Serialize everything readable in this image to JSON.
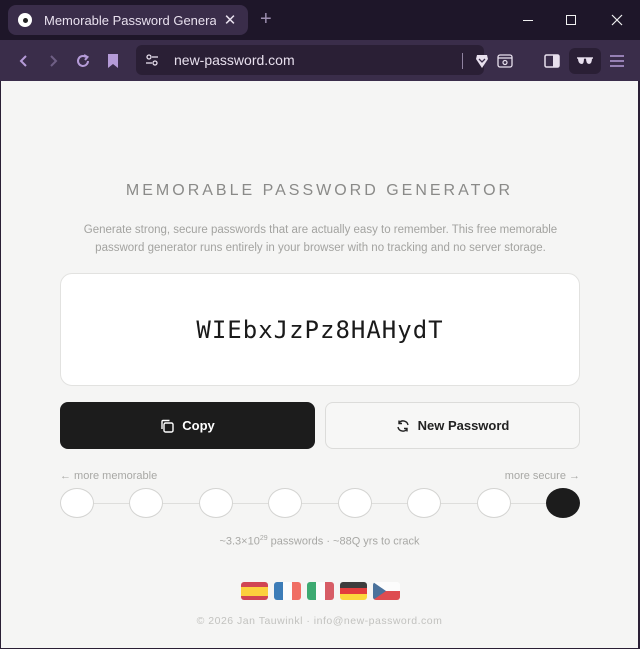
{
  "browser": {
    "tab_title": "Memorable Password Generator",
    "tab_close": "✕",
    "new_tab": "+",
    "url": "new-password.com"
  },
  "page": {
    "heading": "MEMORABLE PASSWORD GENERATOR",
    "description": "Generate strong, secure passwords that are actually easy to remember. This free memorable password generator runs entirely in your browser with no tracking and no server storage.",
    "password": "WIEbxJzPz8HAHydT",
    "copy_label": "Copy",
    "new_password_label": "New Password",
    "slider": {
      "left_label": "← more memorable",
      "right_label": "more secure →",
      "steps": 8,
      "selected": 8
    },
    "stats": {
      "prefix": "~3.3×10",
      "exponent": "29",
      "suffix": " passwords · ~88Q yrs to crack"
    },
    "languages": [
      "es",
      "fr",
      "it",
      "de",
      "cz"
    ],
    "footer": "© 2026 Jan Tauwinkl  ·  info@new-password.com"
  },
  "colors": {
    "accent_dark": "#1c1c1c",
    "browser_chrome": "#3a2d4a"
  }
}
